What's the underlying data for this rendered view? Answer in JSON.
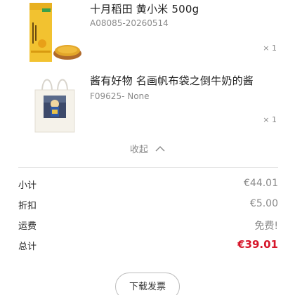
{
  "items": [
    {
      "title": "十月稻田 黄小米 500g",
      "sku": "A08085-20260514",
      "qty": "× 1",
      "image": "millet-package-image"
    },
    {
      "title": "酱有好物 名画帆布袋之倒牛奶的酱",
      "sku": "F09625- None",
      "qty": "× 1",
      "image": "tote-bag-image"
    }
  ],
  "collapse": {
    "label": "收起",
    "icon": "chevron-up-icon"
  },
  "summary": {
    "subtotal": {
      "label": "小计",
      "value": "€44.01"
    },
    "discount": {
      "label": "折扣",
      "value": "€5.00"
    },
    "shipping": {
      "label": "运费",
      "value": "免费!"
    },
    "total": {
      "label": "总计",
      "value": "€39.01"
    }
  },
  "colors": {
    "total": "#d6162a",
    "muted": "#8a8a8a",
    "divider": "#e6e6e6"
  },
  "invoice_button": {
    "label": "下载发票"
  }
}
